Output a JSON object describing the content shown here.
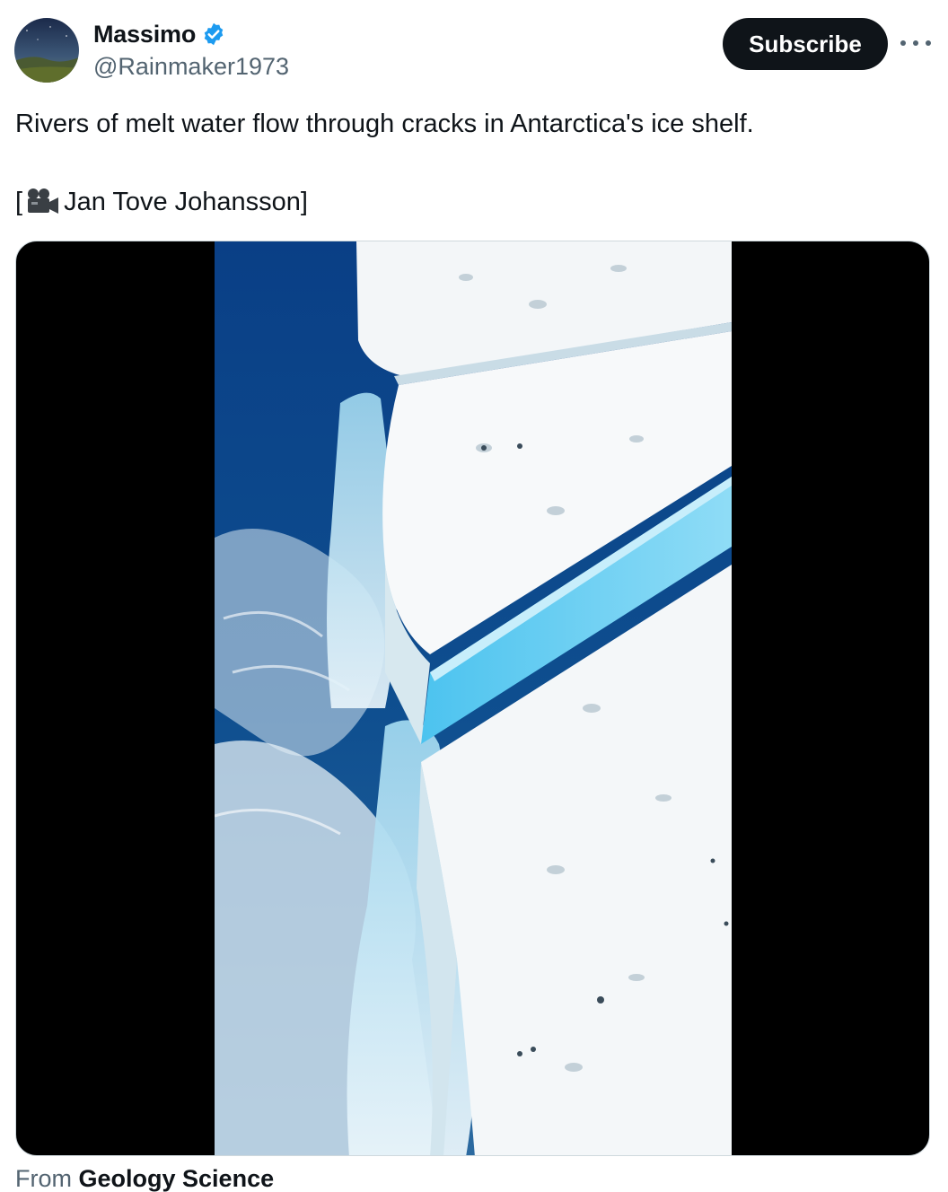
{
  "author": {
    "name": "Massimo",
    "handle": "@Rainmaker1973",
    "verified": true
  },
  "actions": {
    "subscribe_label": "Subscribe",
    "more_icon": "more-horizontal-icon"
  },
  "tweet": {
    "text": "Rivers of melt water flow through cracks in Antarctica's ice shelf.",
    "credit_open": "[",
    "credit_icon": "video-camera-icon",
    "credit_name": "Jan Tove Johansson]"
  },
  "media": {
    "type": "video",
    "subject": "aerial-view-ice-shelf-meltwater-waterfall"
  },
  "source": {
    "prefix": "From",
    "name": "Geology Science"
  },
  "colors": {
    "text": "#0f1419",
    "secondary": "#536471",
    "verified": "#1d9bf0",
    "button_bg": "#0f1419"
  }
}
